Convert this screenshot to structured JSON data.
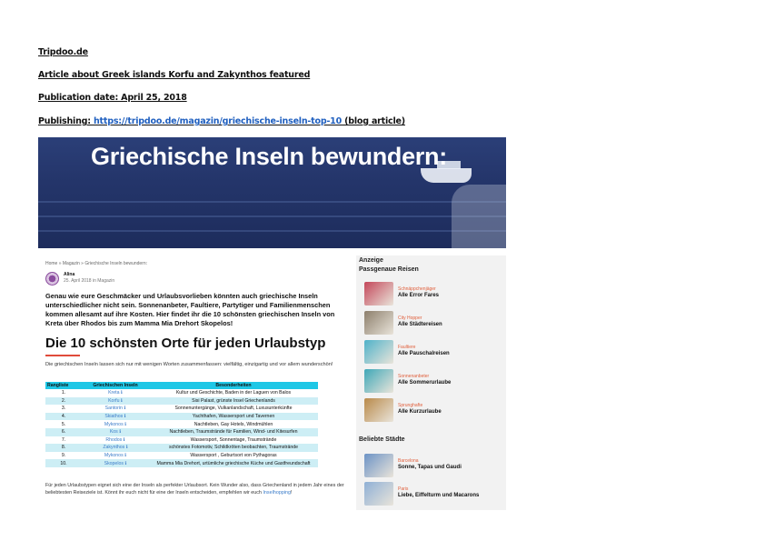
{
  "doc": {
    "site": "Tripdoo.de",
    "article": "Article about Greek islands Korfu and Zakynthos featured",
    "date": "Publication date: April 25, 2018",
    "publishing_label": "Publishing: ",
    "publishing_url": "https://tripdoo.de/magazin/griechische-inseln-top-10",
    "publishing_suffix": " (blog article)"
  },
  "hero": {
    "title": "Griechische Inseln bewundern:"
  },
  "article": {
    "breadcrumb": "Home  »  Magazin  »  Griechische Inseln bewundern:",
    "author": "Alina",
    "meta": "25. April 2018 in Magazin",
    "intro": "Genau wie eure Geschmäcker und Urlaubsvorlieben könnten auch griechische Inseln unterschiedlicher nicht sein. Sonnenanbeter, Faultiere, Partytiger und Familienmenschen kommen allesamt auf ihre Kosten. Hier findet ihr die 10 schönsten griechischen Inseln von Kreta über Rhodos bis zum Mamma Mia Drehort Skopelos!",
    "heading": "Die 10 schönsten Orte für jeden Urlaubstyp",
    "lead": "Die griechischen Inseln lassen sich nur mit wenigen Worten zusammenfassen: vielfältig, einzigartig und vor allem wunderschön!",
    "table": {
      "headers": [
        "Rangliste",
        "Griechischen Inseln",
        "Besonderheiten"
      ],
      "rows": [
        [
          "1.",
          "Kreta ℹ",
          "Kultur und Geschichte, Baden in der Laguen von Balos"
        ],
        [
          "2.",
          "Korfu ℹ",
          "Sisi Palast, grünste Insel Griechenlands"
        ],
        [
          "3.",
          "Santorin ℹ",
          "Sonnenuntergänge, Vulkanlandschaft, Luxusunterkünfte"
        ],
        [
          "4.",
          "Skiathos ℹ",
          "Yachthafen, Wassersport und Tavernen"
        ],
        [
          "5.",
          "Mykonos ℹ",
          "Nachtleben, Gay Hotels, Windmühlen"
        ],
        [
          "6.",
          "Kos ℹ",
          "Nachtleben, Traumstrände für Familien, Wind- und Kitesurfen"
        ],
        [
          "7.",
          "Rhodos ℹ",
          "Wassersport, Sonnentage, Traumstrände"
        ],
        [
          "8.",
          "Zakynthos ℹ",
          "schönstes Fotomotiv, Schildkröten beobachten, Traumstrände"
        ],
        [
          "9.",
          "Mykonos ℹ",
          "Wassersport , Geburtsort von Pythagoras"
        ],
        [
          "10.",
          "Skopelos ℹ",
          "Mamma Mia Drehort, urtümliche griechische Küche und Gastfreundschaft"
        ]
      ]
    },
    "outro": "Für jeden Urlaubstypen eignet sich eine der Inseln als perfekter Urlaubsort. Kein Wunder also, dass Griechenland in jedem Jahr eines der beliebtesten Reiseziele ist. Könnt ihr euch nicht für eine der Inseln entscheiden, empfehlen wir euch ",
    "outro_link": "Inselhopping",
    "outro_end": "!"
  },
  "sidebar": {
    "ad_label": "Anzeige",
    "ad_title": "Passgenaue Reisen",
    "deals": [
      {
        "category": "Schnäppchenjäger",
        "title": "Alle Error Fares",
        "color": "#c4475a"
      },
      {
        "category": "City Hopper",
        "title": "Alle Städtereisen",
        "color": "#8d7f6c"
      },
      {
        "category": "Faultiere",
        "title": "Alle Pauschalreisen",
        "color": "#4fb2c9"
      },
      {
        "category": "Sonnenanbeter",
        "title": "Alle Sommerurlaube",
        "color": "#3fa8b8"
      },
      {
        "category": "Sprunghafte",
        "title": "Alle Kurzurlaube",
        "color": "#b98a4a"
      }
    ],
    "cities_title": "Beliebte Städte",
    "cities": [
      {
        "category": "Barcelona",
        "title": "Sonne, Tapas und Gaudi",
        "color": "#6c93c6"
      },
      {
        "category": "Paris",
        "title": "Liebe, Eiffelturm und Macarons",
        "color": "#8fb0d6"
      }
    ]
  }
}
